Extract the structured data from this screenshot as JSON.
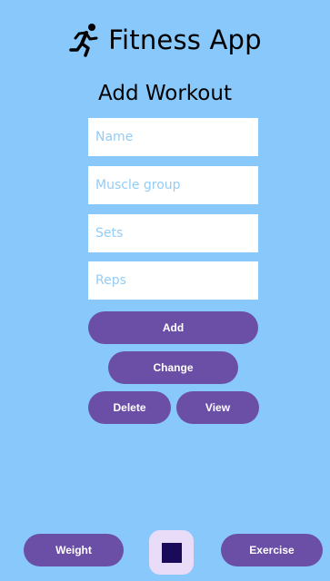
{
  "app": {
    "title": "Fitness App"
  },
  "page": {
    "title": "Add Workout"
  },
  "form": {
    "name_placeholder": "Name",
    "muscle_group_placeholder": "Muscle group",
    "sets_placeholder": "Sets",
    "reps_placeholder": "Reps"
  },
  "actions": {
    "add_label": "Add",
    "change_label": "Change",
    "delete_label": "Delete",
    "view_label": "View"
  },
  "bottom_nav": {
    "weight_label": "Weight",
    "exercise_label": "Exercise"
  },
  "icons": {
    "app_icon": "running-person-icon",
    "fab_icon": "square-stop-icon"
  },
  "colors": {
    "background": "#89c8fb",
    "button": "#6b4fa6",
    "fab_background": "#e8dcf8",
    "fab_square": "#1a0a5a",
    "placeholder": "#92cdf7"
  }
}
